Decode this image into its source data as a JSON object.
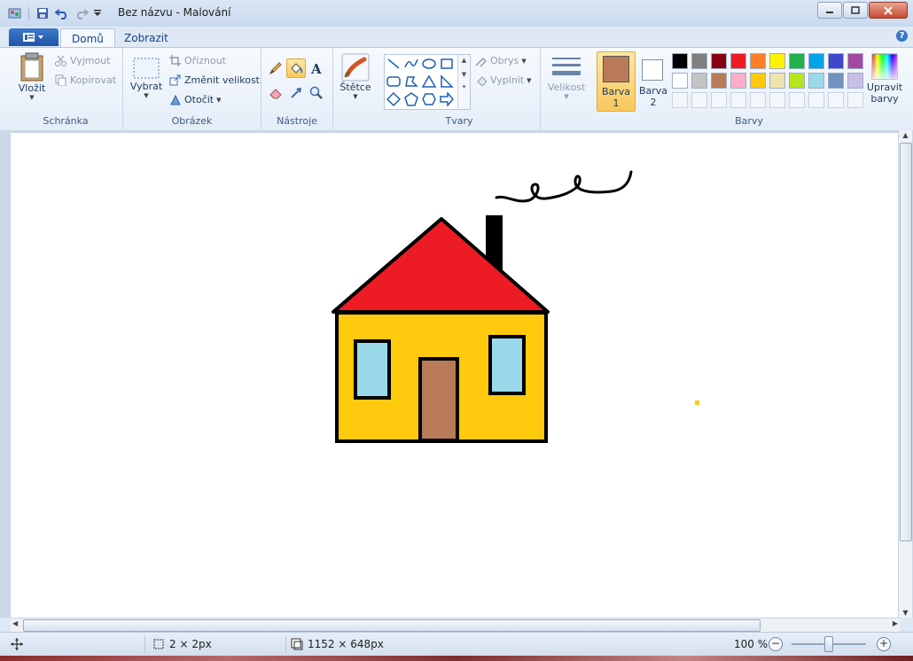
{
  "window": {
    "title": "Bez názvu - Malování"
  },
  "tabs": [
    {
      "label": "Domů",
      "active": true
    },
    {
      "label": "Zobrazit",
      "active": false
    }
  ],
  "help_label": "?",
  "groups": {
    "clipboard": {
      "label": "Schránka",
      "paste": "Vložit",
      "cut": "Vyjmout",
      "copy": "Kopírovat"
    },
    "image": {
      "label": "Obrázek",
      "select": "Vybrat",
      "crop": "Oříznout",
      "resize": "Změnit velikost",
      "rotate": "Otočit"
    },
    "tools": {
      "label": "Nástroje",
      "selected": "fill-bucket"
    },
    "brushes": {
      "label": "Štětce"
    },
    "shapes": {
      "label": "Tvary",
      "outline": "Obrys",
      "fill": "Vyplnit"
    },
    "size": {
      "label": "Velikost"
    },
    "colors": {
      "label": "Barvy",
      "color1_label": "Barva",
      "color1_num": "1",
      "color1_value": "#b97a57",
      "color2_label": "Barva",
      "color2_num": "2",
      "color2_value": "#ffffff",
      "edit_label_1": "Upravit",
      "edit_label_2": "barvy",
      "palette_row1": [
        "#000000",
        "#7f7f7f",
        "#880015",
        "#ed1c24",
        "#ff7f27",
        "#fff200",
        "#22b14c",
        "#00a2e8",
        "#3f48cc",
        "#a349a4"
      ],
      "palette_row2": [
        "#ffffff",
        "#c3c3c3",
        "#b97a57",
        "#ffaec9",
        "#ffc90e",
        "#efe4b0",
        "#b5e61d",
        "#99d9ea",
        "#7092be",
        "#c8bfe7"
      ],
      "palette_empty_count": 10
    }
  },
  "drawing": {
    "wall_color": "#ffc90e",
    "roof_color": "#ed1c24",
    "window_color": "#99d9ea",
    "door_color": "#b97a57",
    "outline_color": "#000000",
    "dot_color": "#ffc90e"
  },
  "status": {
    "selection_size": "2 × 2px",
    "canvas_size": "1152 × 648px",
    "zoom": "100 %"
  }
}
